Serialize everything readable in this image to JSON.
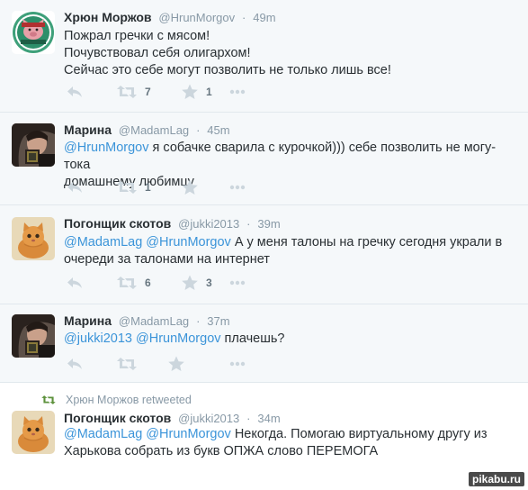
{
  "tweets": [
    {
      "name": "Хрюн Моржов",
      "handle": "@HrunMorgov",
      "time": "49m",
      "lines": [
        "Пожрал гречки с мясом!",
        "Почувствовал себя олигархом!",
        "Сейчас это себе могут позволить не только лишь все!"
      ],
      "retweets": "7",
      "favorites": "1"
    },
    {
      "name": "Марина",
      "handle": "@MadamLag",
      "time": "45m",
      "mention": "@HrunMorgov",
      "text_1": " я собачке сварила с курочкой))) себе позволить не могу-тока",
      "text_2": "домашнему любимцу",
      "retweets": "1"
    },
    {
      "name": "Погонщик скотов",
      "handle": "@jukki2013",
      "time": "39m",
      "mention_1": "@MadamLag",
      "mention_2": "@HrunMorgov",
      "text_1": " А у меня талоны на гречку сегодня украли в",
      "text_2": "очереди за талонами на интернет",
      "retweets": "6",
      "favorites": "3"
    },
    {
      "name": "Марина",
      "handle": "@MadamLag",
      "time": "37m",
      "mention_1": "@jukki2013",
      "mention_2": "@HrunMorgov",
      "text_1": " плачешь?"
    },
    {
      "retweeted_by": "Хрюн Моржов retweeted",
      "name": "Погонщик скотов",
      "handle": "@jukki2013",
      "time": "34m",
      "mention_1": "@MadamLag",
      "mention_2": "@HrunMorgov",
      "text_1": " Некогда. Помогаю виртуальному другу из",
      "text_2": "Харькова собрать из букв ОПЖА слово ПЕРЕМОГА"
    }
  ],
  "watermark": "pikabu.ru",
  "colors": {
    "link": "#3b94d9",
    "meta": "#8899a6",
    "icon": "#ccd6dd",
    "retweet_green": "#5c913b"
  },
  "icons": [
    "reply-icon",
    "retweet-icon",
    "favorite-icon",
    "more-icon"
  ]
}
